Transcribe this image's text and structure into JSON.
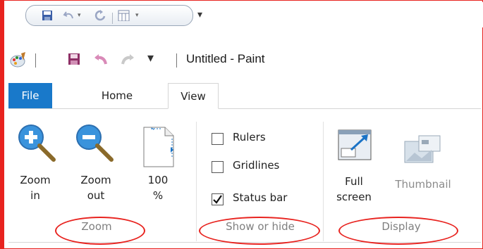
{
  "quick_access": {
    "items": [
      {
        "icon": "save-icon"
      },
      {
        "icon": "undo-icon"
      },
      {
        "icon": "redo-icon"
      },
      {
        "icon": "window-icon"
      }
    ],
    "customize_glyph": "▾"
  },
  "titlebar": {
    "app_icon": "paint-palette-icon",
    "title": "Untitled - Paint",
    "customize_glyph": "▾"
  },
  "tabs": [
    {
      "label": "File"
    },
    {
      "label": "Home"
    },
    {
      "label": "View"
    }
  ],
  "groups": {
    "zoom": {
      "label": "Zoom",
      "zoom_in_line1": "Zoom",
      "zoom_in_line2": "in",
      "zoom_out_line1": "Zoom",
      "zoom_out_line2": "out",
      "hundred_line1": "100",
      "hundred_line2": "%"
    },
    "show_hide": {
      "label": "Show or hide",
      "rulers": {
        "label": "Rulers",
        "checked": false
      },
      "gridlines": {
        "label": "Gridlines",
        "checked": false
      },
      "status_bar": {
        "label": "Status bar",
        "checked": true
      }
    },
    "display": {
      "label": "Display",
      "full_line1": "Full",
      "full_line2": "screen",
      "thumbnail": "Thumbnail"
    }
  },
  "colors": {
    "accent": "#1979ca",
    "annotation": "#e8231f"
  }
}
